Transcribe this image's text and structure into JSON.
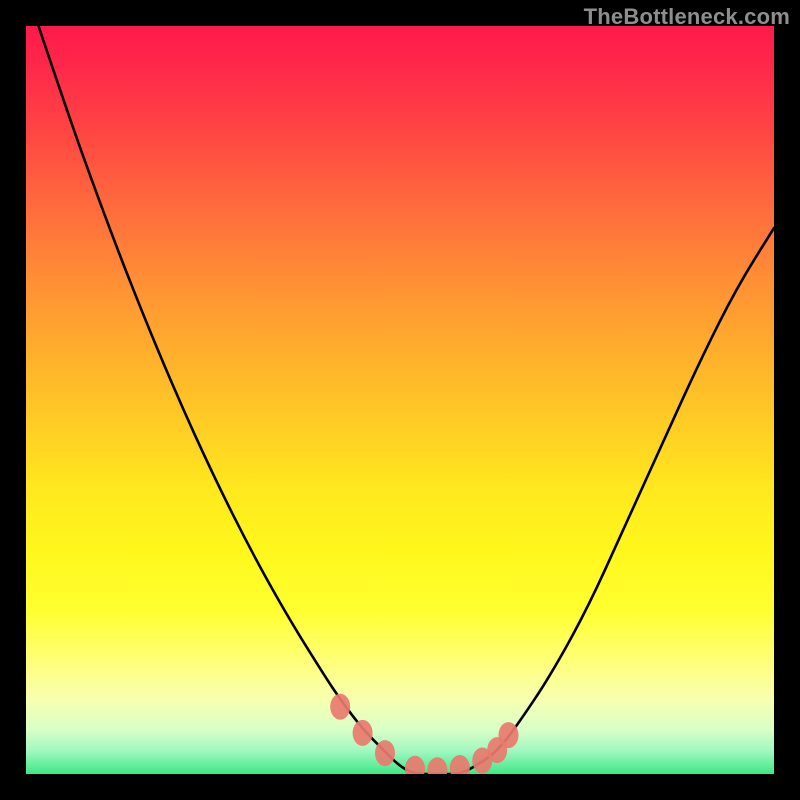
{
  "watermark": {
    "text": "TheBottleneck.com"
  },
  "chart_data": {
    "type": "line",
    "title": "",
    "xlabel": "",
    "ylabel": "",
    "xlim": [
      0,
      100
    ],
    "ylim": [
      0,
      100
    ],
    "series": [
      {
        "name": "bottleneck-curve",
        "x": [
          0,
          5,
          10,
          15,
          20,
          25,
          30,
          35,
          40,
          42,
          45,
          48,
          50,
          52,
          55,
          58,
          60,
          63,
          66,
          70,
          75,
          80,
          85,
          90,
          95,
          100
        ],
        "values": [
          105,
          90,
          76,
          63,
          51,
          40,
          30,
          21,
          13,
          10,
          6,
          3,
          1,
          0,
          0,
          0,
          1,
          3,
          7,
          13,
          22,
          33,
          44,
          55,
          65,
          73
        ]
      }
    ],
    "markers": {
      "name": "curve-floor-markers",
      "x": [
        42,
        45,
        48,
        52,
        55,
        58,
        61,
        63,
        64.5
      ],
      "values": [
        9.0,
        5.5,
        2.8,
        0.7,
        0.5,
        0.8,
        1.8,
        3.2,
        5.2
      ]
    },
    "gradient_stops": [
      {
        "pct": 0,
        "color": "#ff1a4b"
      },
      {
        "pct": 50,
        "color": "#ffcf24"
      },
      {
        "pct": 85,
        "color": "#ffff7a"
      },
      {
        "pct": 100,
        "color": "#3ee884"
      }
    ]
  }
}
